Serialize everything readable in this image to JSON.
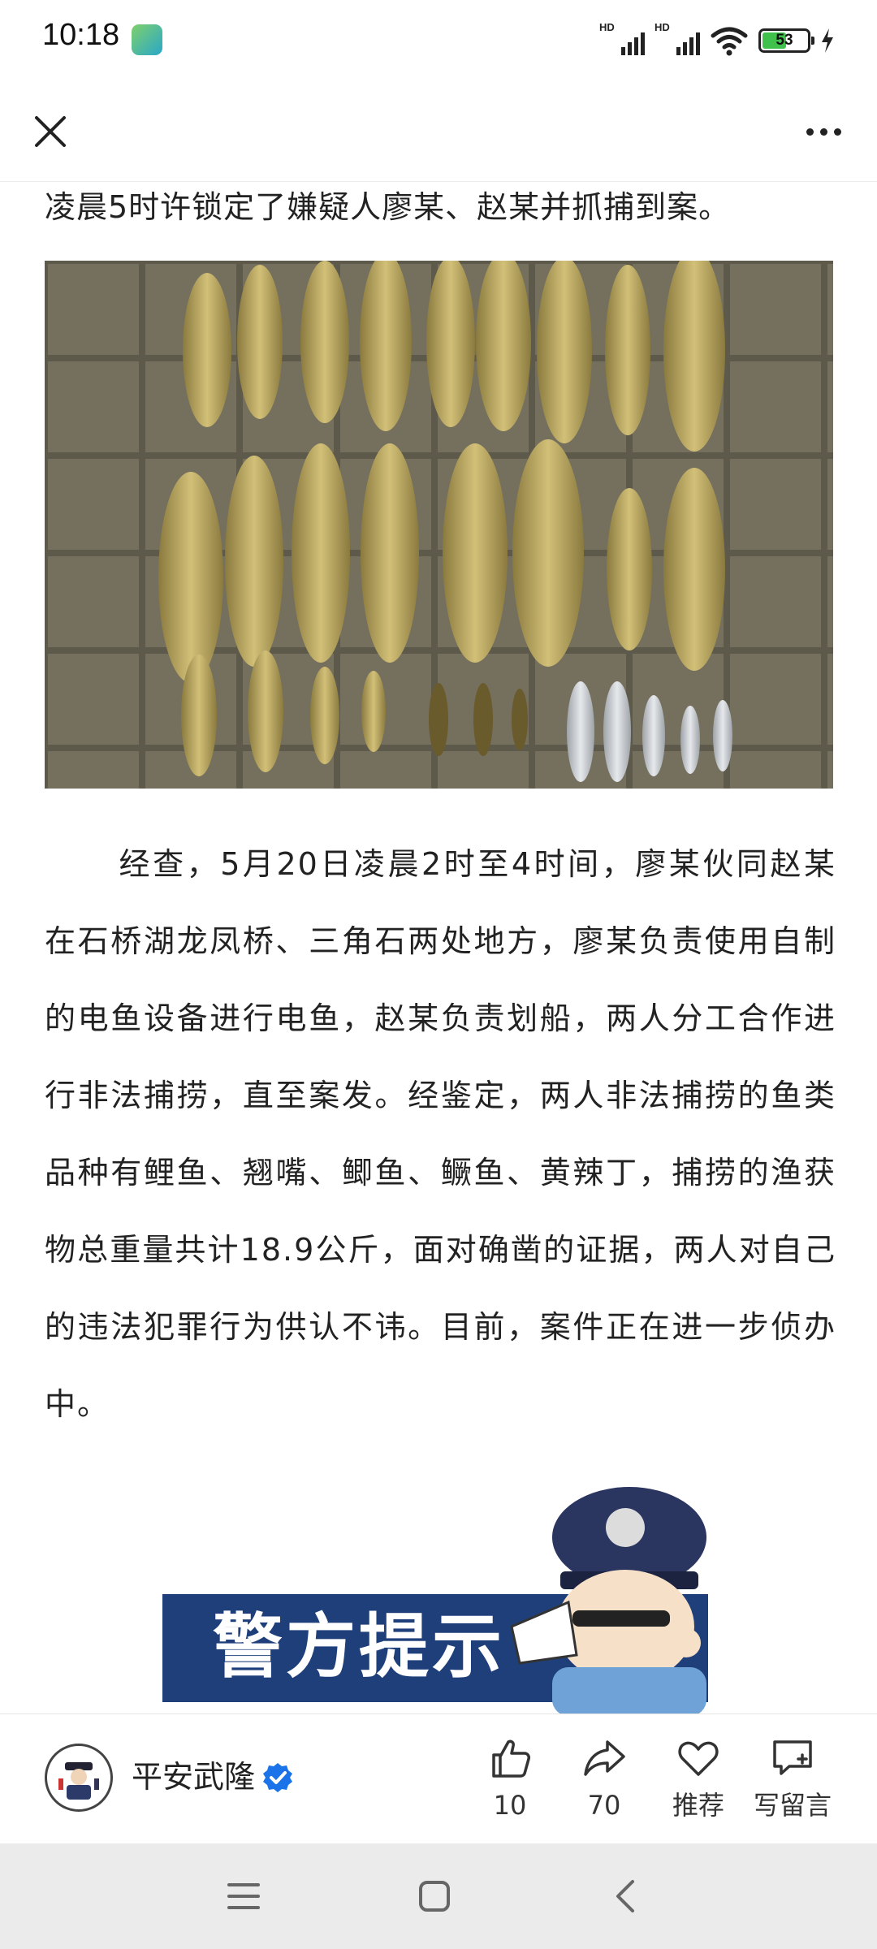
{
  "status_bar": {
    "time": "10:18",
    "signal1_label": "HD",
    "signal2_label": "HD",
    "battery_level": "53",
    "icons": [
      "app-notification-icon",
      "signal-icon",
      "signal-icon",
      "wifi-icon",
      "battery-icon",
      "charging-icon"
    ]
  },
  "nav": {
    "close_icon": "close-icon",
    "more_icon": "more-icon"
  },
  "article": {
    "lead_line": "凌晨5时许锁定了嫌疑人廖某、赵某并抓捕到案。",
    "body": "经查，5月20日凌晨2时至4时间，廖某伙同赵某在石桥湖龙凤桥、三角石两处地方，廖某负责使用自制的电鱼设备进行电鱼，赵某负责划船，两人分工合作进行非法捕捞，直至案发。经鉴定，两人非法捕捞的鱼类品种有鲤鱼、翘嘴、鲫鱼、鳜鱼、黄辣丁，捕捞的渔获物总重量共计18.9公斤，面对确凿的证据，两人对自己的违法犯罪行为供认不讳。目前，案件正在进一步侦办中。",
    "banner_text": "警方提示"
  },
  "action_bar": {
    "account_name": "平安武隆",
    "like_count": "10",
    "share_count": "70",
    "recommend_label": "推荐",
    "comment_label": "写留言"
  },
  "colors": {
    "banner_blue": "#1f3f7b",
    "verified_blue": "#1a73e8",
    "battery_green": "#3fc14b"
  }
}
